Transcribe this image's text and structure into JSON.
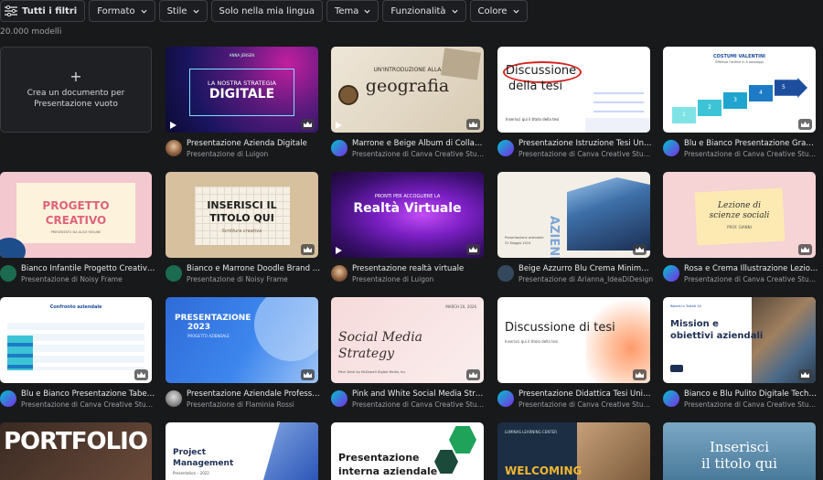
{
  "filters": {
    "all_filters": "Tutti i filtri",
    "format": "Formato",
    "style": "Stile",
    "my_language": "Solo nella mia lingua",
    "theme": "Tema",
    "features": "Funzionalità",
    "color": "Colore"
  },
  "results_count": "20.000 modelli",
  "create_card": {
    "label": "Crea un documento per Presentazione vuoto"
  },
  "templates": [
    {
      "title": "Presentazione Azienda Digitale",
      "author": "Presentazione di Luigon",
      "thumb": {
        "line1": "LA NOSTRA STRATEGIA",
        "line2": "DIGITALE",
        "brand": "ANNA JENSEN"
      }
    },
    {
      "title": "Marrone e Beige Album di Collage ...",
      "author": "Presentazione di Canva Creative Studio",
      "thumb": {
        "line1": "UN'INTRODUZIONE ALLA",
        "line2": "geografia"
      }
    },
    {
      "title": "Presentazione Istruzione Tesi Univ...",
      "author": "Presentazione di Canva Creative Studio",
      "thumb": {
        "line1": "Discussione",
        "line2": "della tesi",
        "caption": "Inserisci qui il titolo della tesi"
      }
    },
    {
      "title": "Blu e Bianco Presentazione Grafic...",
      "author": "Presentazione di Canva Creative Studio",
      "thumb": {
        "line1": "COSTUMI VALENTINI",
        "line2": "Effettua l'ordine in 5 passaggi",
        "steps": [
          "1",
          "2",
          "3",
          "4",
          "5"
        ]
      }
    },
    {
      "title": "Bianco Infantile Progetto Creativo...",
      "author": "Presentazione di Noisy Frame",
      "thumb": {
        "line1": "PROGETTO",
        "line2": "CREATIVO",
        "caption": "PRESENTATO DA ALICE MOLINE"
      }
    },
    {
      "title": "Bianco e Marrone Doodle Brand C...",
      "author": "Presentazione di Noisy Frame",
      "thumb": {
        "line1": "INSERISCI IL",
        "line2": "TITOLO QUI",
        "caption": "Scrittura creativa"
      }
    },
    {
      "title": "Presentazione realtà virtuale",
      "author": "Presentazione di Luigon",
      "thumb": {
        "line1": "PRONTI PER ACCOGLIERE LA",
        "line2": "Realtà Virtuale"
      }
    },
    {
      "title": "Beige Azzurro Blu Crema Minimal ...",
      "author": "Presentazione di Arianna_IdeaDiDesign",
      "thumb": {
        "line1": "AZIENDA",
        "caption": "Presentazione aziendale",
        "date": "31 Maggio 2024"
      }
    },
    {
      "title": "Rosa e Crema Illustrazione Lezion...",
      "author": "Presentazione di Canva Creative Studio",
      "thumb": {
        "line1": "Lezione di",
        "line2": "scienze sociali",
        "caption": "PROF. GIANNI"
      }
    },
    {
      "title": "Blu e Bianco Presentazione Tabell...",
      "author": "Presentazione di Canva Creative Studio",
      "thumb": {
        "line1": "Confronto aziendale"
      }
    },
    {
      "title": "Presentazione Aziendale Professio...",
      "author": "Presentazione di Flaminia Rossi",
      "thumb": {
        "line1": "PRESENTAZIONE",
        "line2": "2023",
        "caption": "PROGETTO AZIENDALE"
      }
    },
    {
      "title": "Pink and White Social Media Strat...",
      "author": "Presentazione di Canva Creative Studio",
      "thumb": {
        "line1": "Social Media",
        "line2": "Strategy",
        "date": "MARCH 20, 2026",
        "caption": "Pitch Deck by McDowell Digital Media, Inc."
      }
    },
    {
      "title": "Presentazione Didattica Tesi Univ...",
      "author": "Presentazione di Canva Creative Studio",
      "thumb": {
        "line1": "Discussione di tesi",
        "caption": "Inserisci qui il titolo della tesi"
      }
    },
    {
      "title": "Bianco e Blu Pulito Digitale Tech A...",
      "author": "Presentazione di Canva Creative Studio",
      "thumb": {
        "line1": "Mission e",
        "line2": "obiettivi aziendali",
        "brand": "Roberti e Talenti Srl"
      }
    },
    {
      "thumb": {
        "line1": "PORTFOLIO"
      }
    },
    {
      "thumb": {
        "line1": "Project",
        "line2": "Management",
        "caption": "Presentation – 2022"
      }
    },
    {
      "thumb": {
        "line1": "Presentazione",
        "line2": "interna aziendale"
      }
    },
    {
      "thumb": {
        "line1": "WELCOMING",
        "brand": "LUMINAS LEARNING CENTER"
      }
    },
    {
      "thumb": {
        "line1": "Inserisci",
        "line2": "il titolo qui"
      }
    }
  ],
  "colors": {
    "background": "#18191b",
    "canva_accent": "#00c4cc"
  }
}
